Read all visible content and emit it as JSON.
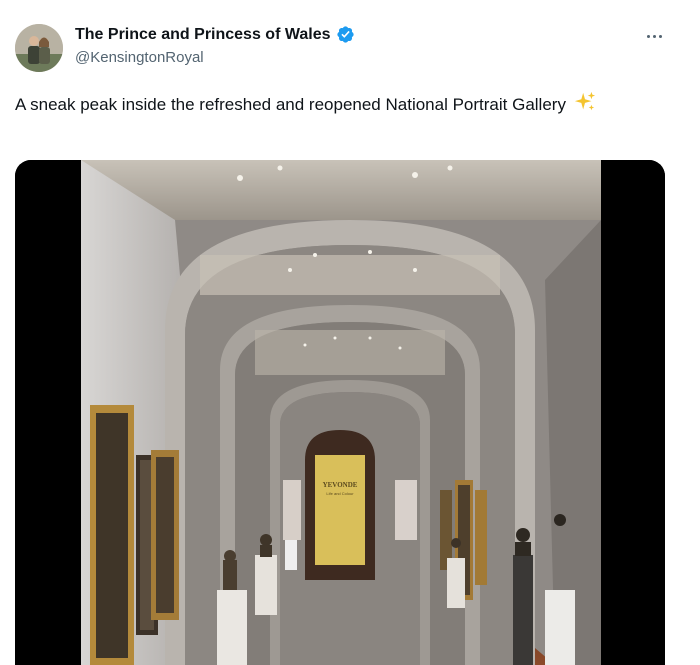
{
  "tweet": {
    "display_name": "The Prince and Princess of Wales",
    "handle": "@KensingtonRoyal",
    "text": "A sneak peak inside the refreshed and reopened National Portrait Gallery",
    "emoji": "✨",
    "more_icon": "more-horizontal-icon",
    "verified_icon": "verified-badge-icon",
    "verified_color": "#1d9bf0"
  },
  "media": {
    "banner_title": "YEVONDE",
    "banner_subtitle": "Life and Colour"
  },
  "colors": {
    "text_primary": "#0f1419",
    "text_secondary": "#536471",
    "banner_yellow": "#d9bf5a"
  }
}
